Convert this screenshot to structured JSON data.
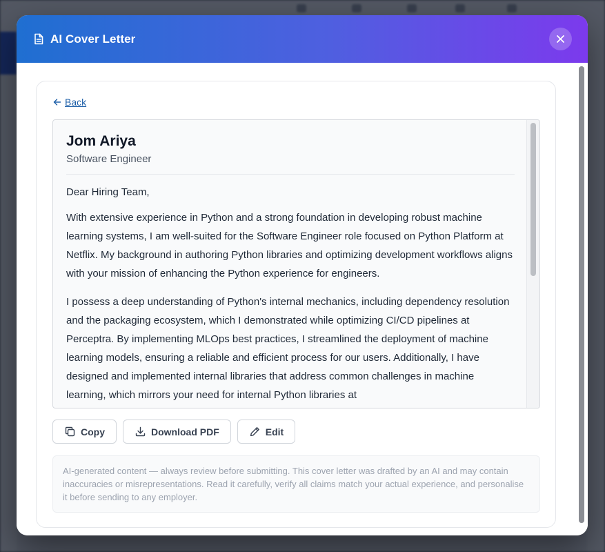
{
  "modal": {
    "title": "AI Cover Letter",
    "close_label": "×"
  },
  "nav": {
    "back_label": "Back"
  },
  "letter": {
    "name": "Jom Ariya",
    "role": "Software Engineer",
    "salutation": "Dear Hiring Team,",
    "paragraphs": [
      "With extensive experience in Python and a strong foundation in developing robust machine learning systems, I am well-suited for the Software Engineer role focused on Python Platform at Netflix. My background in authoring Python libraries and optimizing development workflows aligns with your mission of enhancing the Python experience for engineers.",
      "I possess a deep understanding of Python's internal mechanics, including dependency resolution and the packaging ecosystem, which I demonstrated while optimizing CI/CD pipelines at Perceptra. By implementing MLOps best practices, I streamlined the deployment of machine learning models, ensuring a reliable and efficient process for our users. Additionally, I have designed and implemented internal libraries that address common challenges in machine learning, which mirrors your need for internal Python libraries at"
    ]
  },
  "actions": {
    "copy_label": "Copy",
    "download_label": "Download PDF",
    "edit_label": "Edit"
  },
  "disclaimer": {
    "text": "AI-generated content — always review before submitting. This cover letter was drafted by an AI and may contain inaccuracies or misrepresentations. Read it carefully, verify all claims match your actual experience, and personalise it before sending to any employer."
  },
  "icons": {
    "header": "document-icon",
    "close": "close-icon",
    "back": "arrow-left-icon",
    "copy": "copy-icon",
    "download": "download-icon",
    "edit": "pencil-icon"
  },
  "colors": {
    "header_gradient_start": "#1f6fd1",
    "header_gradient_end": "#7c3aed",
    "link": "#1d5fa8",
    "disclaimer_text": "#9ca3af"
  }
}
